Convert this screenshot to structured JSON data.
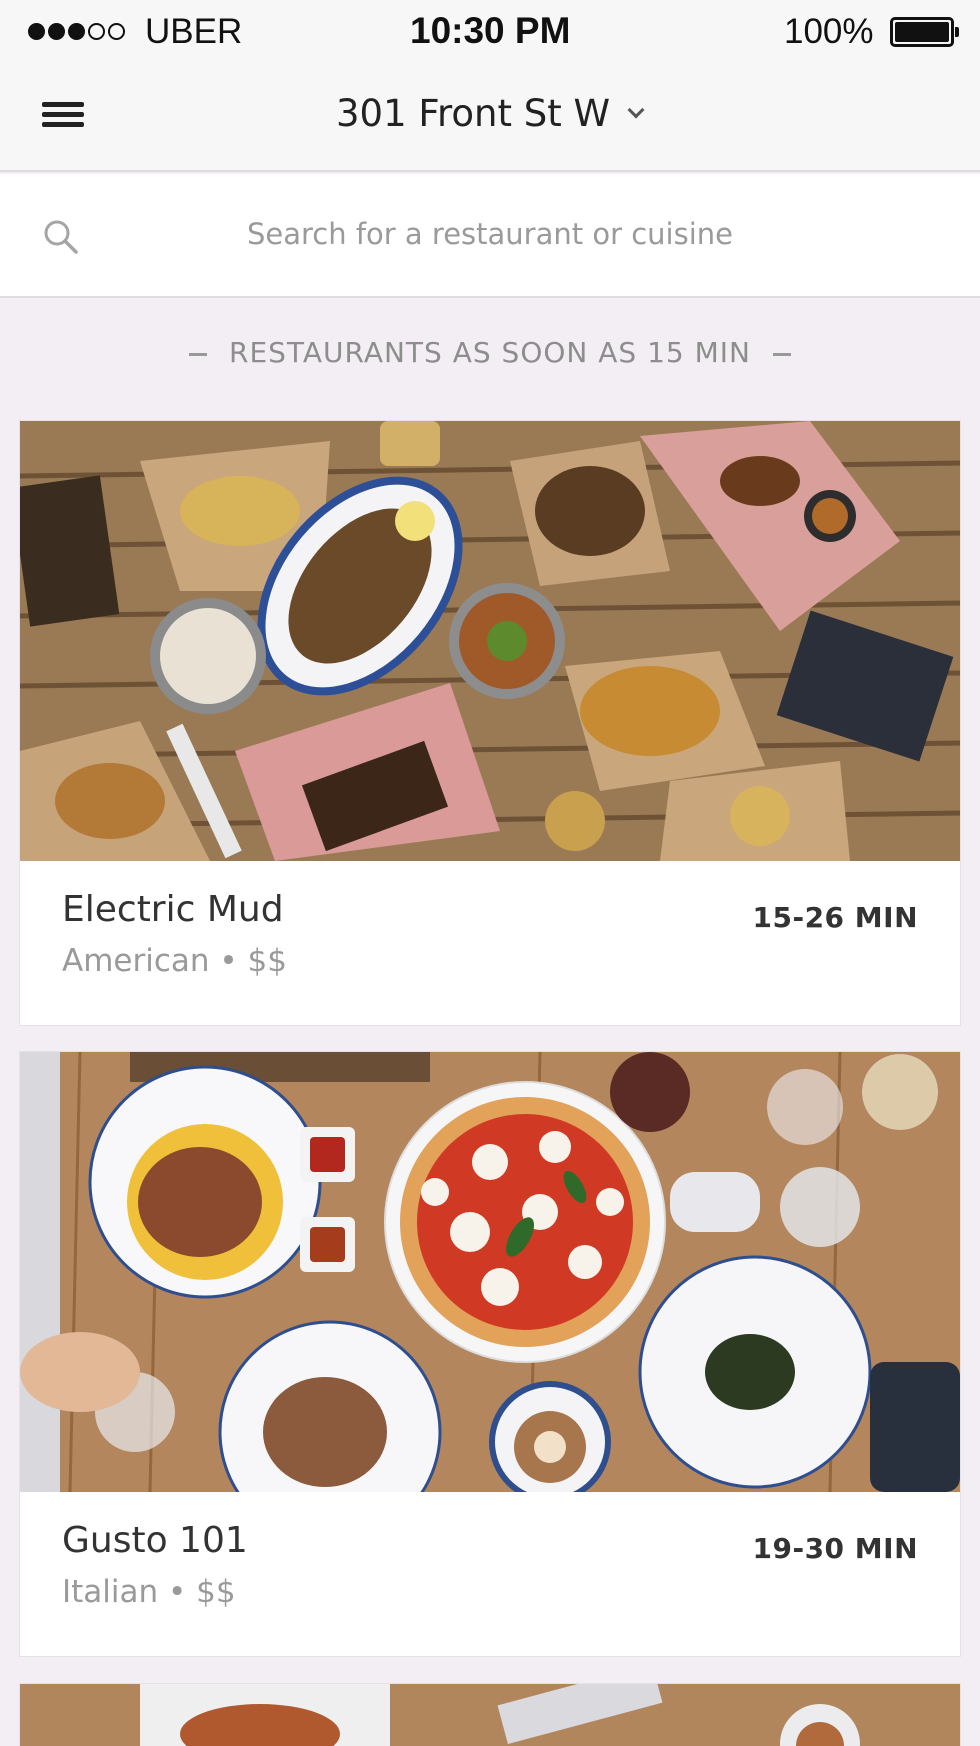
{
  "status_bar": {
    "carrier": "UBER",
    "time": "10:30 PM",
    "battery": "100%",
    "signal_bars_filled": 3,
    "signal_bars_total": 5
  },
  "nav": {
    "location": "301 Front St W",
    "menu_icon": "hamburger-menu-icon",
    "dropdown_icon": "chevron-down-icon"
  },
  "search": {
    "placeholder": "Search for a restaurant or cuisine",
    "value": "",
    "icon": "search-icon"
  },
  "section": {
    "title": "RESTAURANTS AS SOON AS 15 MIN"
  },
  "restaurants": [
    {
      "name": "Electric Mud",
      "meta": "American • $$",
      "eta": "15-26 MIN"
    },
    {
      "name": "Gusto 101",
      "meta": "Italian • $$",
      "eta": "19-30 MIN"
    }
  ],
  "colors": {
    "background": "#f3eef4",
    "bar": "#f7f7f7",
    "text": "#333333",
    "muted": "#9a9a9a"
  }
}
